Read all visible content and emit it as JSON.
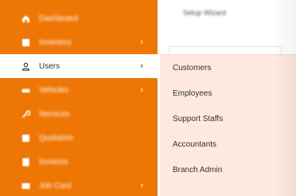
{
  "sidebar": {
    "items": [
      {
        "label": "Dashboard",
        "icon": "home-icon",
        "chevron": ""
      },
      {
        "label": "Inventory",
        "icon": "grid-icon",
        "chevron": "›"
      },
      {
        "label": "Users",
        "icon": "user-icon",
        "chevron": "›"
      },
      {
        "label": "Vehicles",
        "icon": "car-icon",
        "chevron": "›"
      },
      {
        "label": "Services",
        "icon": "wrench-icon",
        "chevron": ""
      },
      {
        "label": "Quotation",
        "icon": "quote-icon",
        "chevron": ""
      },
      {
        "label": "Invoices",
        "icon": "invoice-icon",
        "chevron": ""
      },
      {
        "label": "Job Card",
        "icon": "card-icon",
        "chevron": "›"
      }
    ]
  },
  "header": {
    "title": "Setup Wizard"
  },
  "users_menu": {
    "items": [
      "Customers",
      "Employees",
      "Support Staffs",
      "Accountants",
      "Branch Admin"
    ]
  },
  "colors": {
    "sidebar": "#ee7604",
    "dropdown": "#fde9df"
  }
}
